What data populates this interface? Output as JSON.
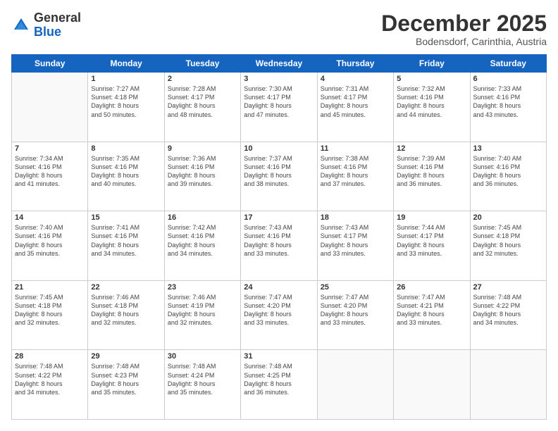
{
  "header": {
    "logo_general": "General",
    "logo_blue": "Blue",
    "month": "December 2025",
    "location": "Bodensdorf, Carinthia, Austria"
  },
  "days_of_week": [
    "Sunday",
    "Monday",
    "Tuesday",
    "Wednesday",
    "Thursday",
    "Friday",
    "Saturday"
  ],
  "weeks": [
    [
      {
        "num": "",
        "info": ""
      },
      {
        "num": "1",
        "info": "Sunrise: 7:27 AM\nSunset: 4:18 PM\nDaylight: 8 hours\nand 50 minutes."
      },
      {
        "num": "2",
        "info": "Sunrise: 7:28 AM\nSunset: 4:17 PM\nDaylight: 8 hours\nand 48 minutes."
      },
      {
        "num": "3",
        "info": "Sunrise: 7:30 AM\nSunset: 4:17 PM\nDaylight: 8 hours\nand 47 minutes."
      },
      {
        "num": "4",
        "info": "Sunrise: 7:31 AM\nSunset: 4:17 PM\nDaylight: 8 hours\nand 45 minutes."
      },
      {
        "num": "5",
        "info": "Sunrise: 7:32 AM\nSunset: 4:16 PM\nDaylight: 8 hours\nand 44 minutes."
      },
      {
        "num": "6",
        "info": "Sunrise: 7:33 AM\nSunset: 4:16 PM\nDaylight: 8 hours\nand 43 minutes."
      }
    ],
    [
      {
        "num": "7",
        "info": "Sunrise: 7:34 AM\nSunset: 4:16 PM\nDaylight: 8 hours\nand 41 minutes."
      },
      {
        "num": "8",
        "info": "Sunrise: 7:35 AM\nSunset: 4:16 PM\nDaylight: 8 hours\nand 40 minutes."
      },
      {
        "num": "9",
        "info": "Sunrise: 7:36 AM\nSunset: 4:16 PM\nDaylight: 8 hours\nand 39 minutes."
      },
      {
        "num": "10",
        "info": "Sunrise: 7:37 AM\nSunset: 4:16 PM\nDaylight: 8 hours\nand 38 minutes."
      },
      {
        "num": "11",
        "info": "Sunrise: 7:38 AM\nSunset: 4:16 PM\nDaylight: 8 hours\nand 37 minutes."
      },
      {
        "num": "12",
        "info": "Sunrise: 7:39 AM\nSunset: 4:16 PM\nDaylight: 8 hours\nand 36 minutes."
      },
      {
        "num": "13",
        "info": "Sunrise: 7:40 AM\nSunset: 4:16 PM\nDaylight: 8 hours\nand 36 minutes."
      }
    ],
    [
      {
        "num": "14",
        "info": "Sunrise: 7:40 AM\nSunset: 4:16 PM\nDaylight: 8 hours\nand 35 minutes."
      },
      {
        "num": "15",
        "info": "Sunrise: 7:41 AM\nSunset: 4:16 PM\nDaylight: 8 hours\nand 34 minutes."
      },
      {
        "num": "16",
        "info": "Sunrise: 7:42 AM\nSunset: 4:16 PM\nDaylight: 8 hours\nand 34 minutes."
      },
      {
        "num": "17",
        "info": "Sunrise: 7:43 AM\nSunset: 4:16 PM\nDaylight: 8 hours\nand 33 minutes."
      },
      {
        "num": "18",
        "info": "Sunrise: 7:43 AM\nSunset: 4:17 PM\nDaylight: 8 hours\nand 33 minutes."
      },
      {
        "num": "19",
        "info": "Sunrise: 7:44 AM\nSunset: 4:17 PM\nDaylight: 8 hours\nand 33 minutes."
      },
      {
        "num": "20",
        "info": "Sunrise: 7:45 AM\nSunset: 4:18 PM\nDaylight: 8 hours\nand 32 minutes."
      }
    ],
    [
      {
        "num": "21",
        "info": "Sunrise: 7:45 AM\nSunset: 4:18 PM\nDaylight: 8 hours\nand 32 minutes."
      },
      {
        "num": "22",
        "info": "Sunrise: 7:46 AM\nSunset: 4:18 PM\nDaylight: 8 hours\nand 32 minutes."
      },
      {
        "num": "23",
        "info": "Sunrise: 7:46 AM\nSunset: 4:19 PM\nDaylight: 8 hours\nand 32 minutes."
      },
      {
        "num": "24",
        "info": "Sunrise: 7:47 AM\nSunset: 4:20 PM\nDaylight: 8 hours\nand 33 minutes."
      },
      {
        "num": "25",
        "info": "Sunrise: 7:47 AM\nSunset: 4:20 PM\nDaylight: 8 hours\nand 33 minutes."
      },
      {
        "num": "26",
        "info": "Sunrise: 7:47 AM\nSunset: 4:21 PM\nDaylight: 8 hours\nand 33 minutes."
      },
      {
        "num": "27",
        "info": "Sunrise: 7:48 AM\nSunset: 4:22 PM\nDaylight: 8 hours\nand 34 minutes."
      }
    ],
    [
      {
        "num": "28",
        "info": "Sunrise: 7:48 AM\nSunset: 4:22 PM\nDaylight: 8 hours\nand 34 minutes."
      },
      {
        "num": "29",
        "info": "Sunrise: 7:48 AM\nSunset: 4:23 PM\nDaylight: 8 hours\nand 35 minutes."
      },
      {
        "num": "30",
        "info": "Sunrise: 7:48 AM\nSunset: 4:24 PM\nDaylight: 8 hours\nand 35 minutes."
      },
      {
        "num": "31",
        "info": "Sunrise: 7:48 AM\nSunset: 4:25 PM\nDaylight: 8 hours\nand 36 minutes."
      },
      {
        "num": "",
        "info": ""
      },
      {
        "num": "",
        "info": ""
      },
      {
        "num": "",
        "info": ""
      }
    ]
  ]
}
